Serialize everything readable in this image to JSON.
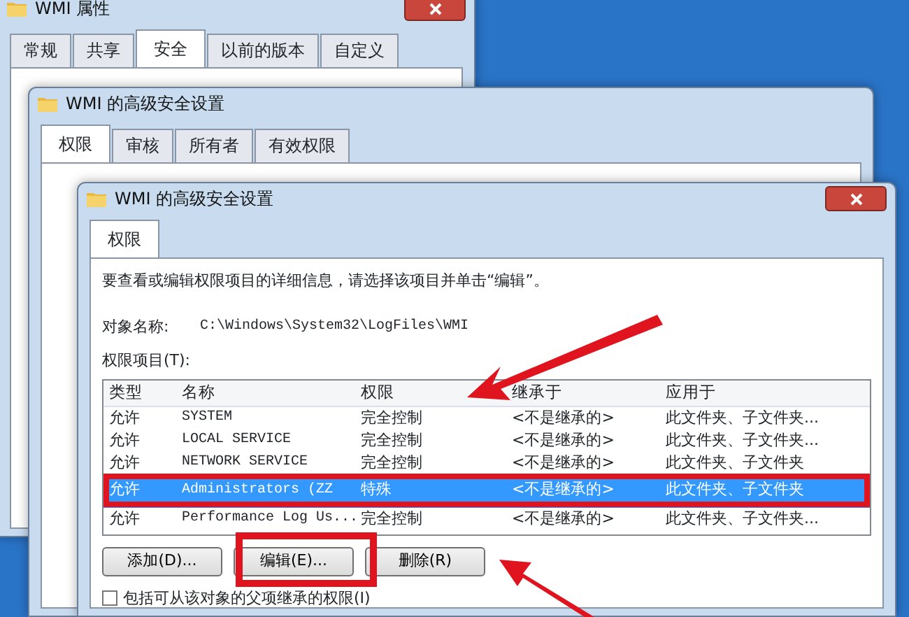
{
  "windows": [
    {
      "title": "WMI 属性",
      "tabs": [
        {
          "label": "常规",
          "selected": false
        },
        {
          "label": "共享",
          "selected": false
        },
        {
          "label": "安全",
          "selected": true
        },
        {
          "label": "以前的版本",
          "selected": false
        },
        {
          "label": "自定义",
          "selected": false
        }
      ]
    },
    {
      "title": "WMI 的高级安全设置",
      "tabs": [
        {
          "label": "权限",
          "selected": true
        },
        {
          "label": "审核",
          "selected": false
        },
        {
          "label": "所有者",
          "selected": false
        },
        {
          "label": "有效权限",
          "selected": false
        }
      ]
    },
    {
      "title": "WMI 的高级安全设置",
      "tabs": [
        {
          "label": "权限",
          "selected": true
        }
      ],
      "instruction": "要查看或编辑权限项目的详细信息，请选择该项目并单击“编辑”。",
      "object_label": "对象名称:",
      "object_value": "C:\\Windows\\System32\\LogFiles\\WMI",
      "entries_label": "权限项目(T):",
      "columns": [
        "类型",
        "名称",
        "权限",
        "继承于",
        "应用于"
      ],
      "rows": [
        {
          "cells": [
            "允许",
            "SYSTEM",
            "完全控制",
            "<不是继承的>",
            "此文件夹、子文件夹..."
          ],
          "selected": false
        },
        {
          "cells": [
            "允许",
            "LOCAL SERVICE",
            "完全控制",
            "<不是继承的>",
            "此文件夹、子文件夹..."
          ],
          "selected": false
        },
        {
          "cells": [
            "允许",
            "NETWORK SERVICE",
            "完全控制",
            "<不是继承的>",
            "此文件夹、子文件夹"
          ],
          "selected": false
        },
        {
          "cells": [
            "允许",
            "Administrators (ZZ",
            "特殊",
            "<不是继承的>",
            "此文件夹、子文件夹"
          ],
          "selected": true
        },
        {
          "cells": [
            "允许",
            "Performance Log Us...",
            "完全控制",
            "<不是继承的>",
            "此文件夹、子文件夹..."
          ],
          "selected": false
        }
      ],
      "buttons": [
        "添加(D)...",
        "编辑(E)...",
        "删除(R)"
      ],
      "checkbox": {
        "label": "包括可从该对象的父项继承的权限(I)",
        "checked": false
      }
    }
  ]
}
